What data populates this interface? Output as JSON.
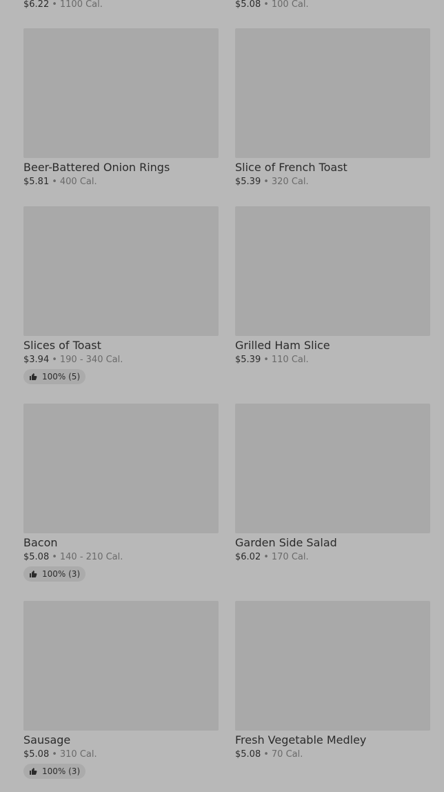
{
  "top_row": [
    {
      "price": "$6.22",
      "calories": "1100 Cal."
    },
    {
      "price": "$5.08",
      "calories": "100 Cal."
    }
  ],
  "items": [
    {
      "name": "Beer-Battered Onion Rings",
      "price": "$5.81",
      "calories": "400 Cal.",
      "rating": ""
    },
    {
      "name": "Slice of French Toast",
      "price": "$5.39",
      "calories": "320 Cal.",
      "rating": ""
    },
    {
      "name": "Slices of Toast",
      "price": "$3.94",
      "calories": "190 - 340 Cal.",
      "rating": "100% (5)"
    },
    {
      "name": "Grilled Ham Slice",
      "price": "$5.39",
      "calories": "110 Cal.",
      "rating": ""
    },
    {
      "name": "Bacon",
      "price": "$5.08",
      "calories": "140 - 210 Cal.",
      "rating": "100% (3)"
    },
    {
      "name": "Garden Side Salad",
      "price": "$6.02",
      "calories": "170 Cal.",
      "rating": ""
    },
    {
      "name": "Sausage",
      "price": "$5.08",
      "calories": "310 Cal.",
      "rating": "100% (3)"
    },
    {
      "name": "Fresh Vegetable Medley",
      "price": "$5.08",
      "calories": "70 Cal.",
      "rating": ""
    }
  ],
  "separator": "•",
  "icons": {
    "rating": "thumbs-up-icon"
  },
  "colors": {
    "background": "#b8b8b8",
    "image_placeholder": "#a9a9a9",
    "rating_pill": "#ababab"
  }
}
